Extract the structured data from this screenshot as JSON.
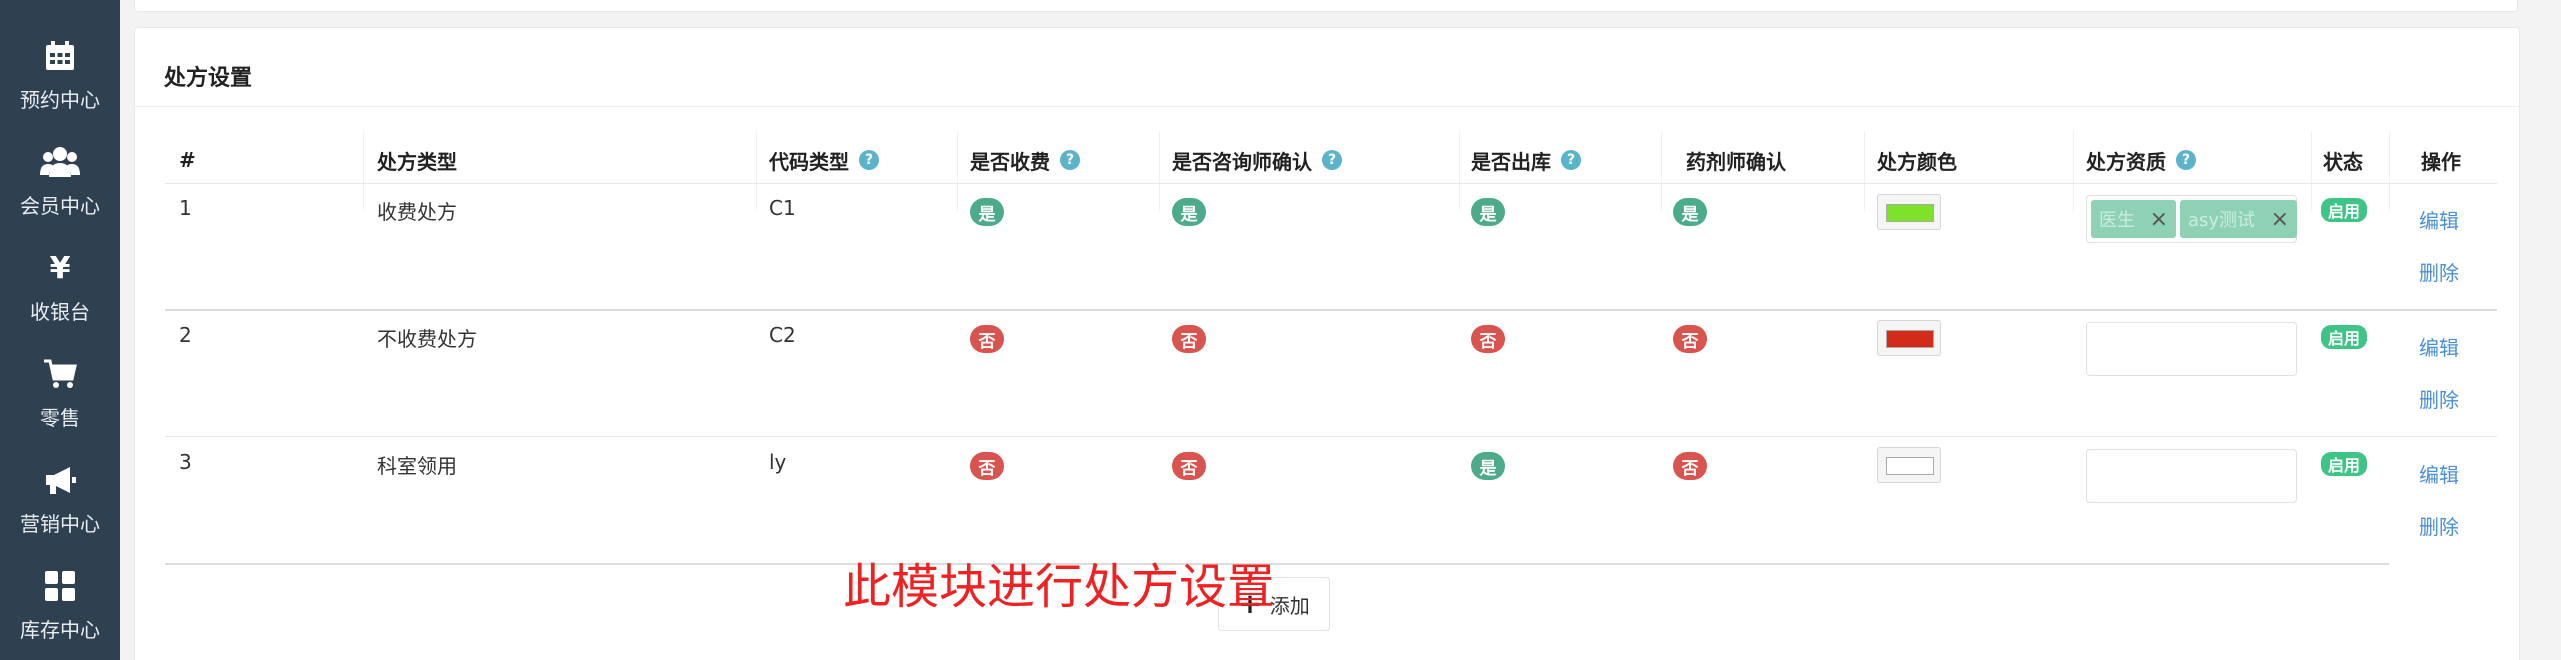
{
  "sidebar": {
    "items": [
      {
        "label": "预约中心",
        "icon": "calendar-icon"
      },
      {
        "label": "会员中心",
        "icon": "users-icon"
      },
      {
        "label": "收银台",
        "icon": "yen-icon"
      },
      {
        "label": "零售",
        "icon": "cart-icon"
      },
      {
        "label": "营销中心",
        "icon": "megaphone-icon"
      },
      {
        "label": "库存中心",
        "icon": "grid-icon"
      }
    ]
  },
  "panel": {
    "title": "处方设置"
  },
  "table": {
    "headers": {
      "index": "#",
      "type": "处方类型",
      "code": "代码类型",
      "charge": "是否收费",
      "consult": "是否咨询师确认",
      "outbound": "是否出库",
      "pharmacist": "药剂师确认",
      "color": "处方颜色",
      "qualification": "处方资质",
      "status": "状态",
      "ops": "操作"
    },
    "rows": [
      {
        "index": "1",
        "type": "收费处方",
        "code": "C1",
        "charge": "是",
        "consult": "是",
        "outbound": "是",
        "pharmacist": "是",
        "color": "#7fe22a",
        "tags": [
          "医生",
          "asy测试"
        ],
        "status": "启用",
        "edit": "编辑",
        "delete": "删除"
      },
      {
        "index": "2",
        "type": "不收费处方",
        "code": "C2",
        "charge": "否",
        "consult": "否",
        "outbound": "否",
        "pharmacist": "否",
        "color": "#d42a1a",
        "tags": [],
        "status": "启用",
        "edit": "编辑",
        "delete": "删除"
      },
      {
        "index": "3",
        "type": "科室领用",
        "code": "ly",
        "charge": "否",
        "consult": "否",
        "outbound": "是",
        "pharmacist": "否",
        "color": "#ffffff",
        "tags": [],
        "status": "启用",
        "edit": "编辑",
        "delete": "删除"
      }
    ]
  },
  "add_button": {
    "label": "添加"
  },
  "annotation": "此模块进行处方设置",
  "help_icon": "?",
  "tag_close": "×",
  "colors": {
    "yes": "#4cab8a",
    "no": "#d9534f",
    "status": "#3ec486",
    "link": "#4a8fd4",
    "sidebar": "#2f4050"
  }
}
